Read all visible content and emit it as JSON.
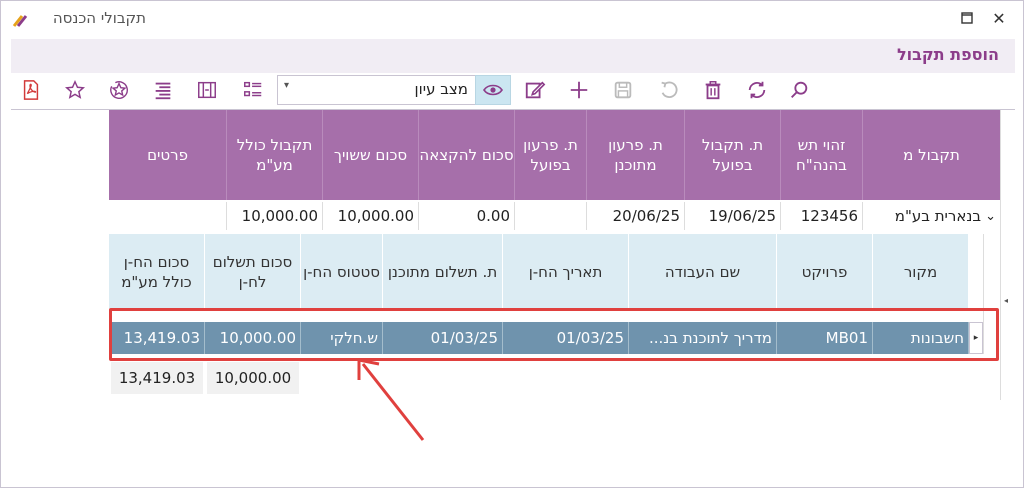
{
  "window": {
    "title": "תקבולי הכנסה",
    "section_title": "הוספת תקבול"
  },
  "toolbar": {
    "view_select_value": "מצב עיון"
  },
  "parent_grid": {
    "headers": [
      "תקבול מ",
      "זהוי תש בהנה\"ח",
      "ת. תקבול בפועל",
      "ת. פרעון מתוכנן",
      "ת. פרעון בפועל",
      "סכום להקצאה",
      "סכום ששויך",
      "תקבול כולל מע\"מ",
      "פרטים"
    ],
    "row": {
      "received_from": "בנארית בע\"מ",
      "accounting_id": "123456",
      "actual_receipt_date": "19/06/25",
      "planned_repayment_date": "20/06/25",
      "actual_repayment_date": "",
      "amount_to_allocate": "0.00",
      "amount_assigned": "10,000.00",
      "receipt_incl_vat": "10,000.00",
      "details": ""
    }
  },
  "child_grid": {
    "headers": [
      "מקור",
      "פרויקט",
      "שם העבודה",
      "תאריך הח-ן",
      "ת. תשלום מתוכנן",
      "סטטוס הח-ן",
      "סכום תשלום לח-ן",
      "סכום הח-ן כולל מע\"מ"
    ],
    "row": {
      "source": "חשבונות",
      "project": "MB01",
      "job_name": "מדריך לתוכנת בנ...",
      "invoice_date": "01/03/25",
      "planned_payment_date": "01/03/25",
      "invoice_status": "ש.חלקי",
      "payment_amount": "10,000.00",
      "invoice_total_incl_vat": "13,419.03"
    },
    "totals": {
      "payment_amount": "10,000.00",
      "invoice_total_incl_vat": "13,419.03"
    }
  },
  "colors": {
    "accent": "#8c3d8a",
    "header_purple": "#a66faa",
    "child_header": "#dcecf3",
    "selected_row": "#6f93ad",
    "highlight_red": "#e0403e"
  }
}
